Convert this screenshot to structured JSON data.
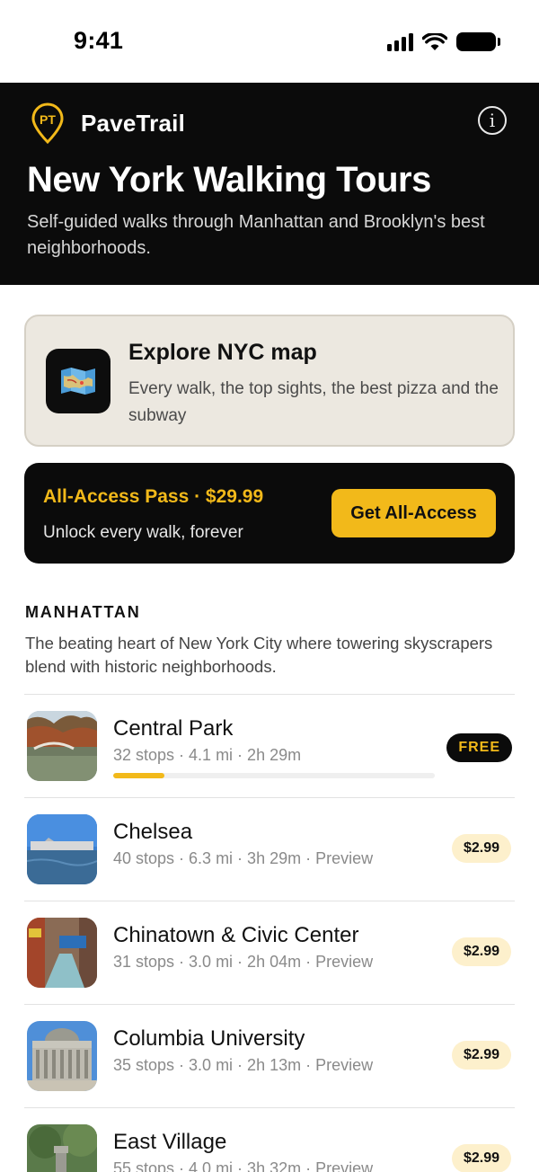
{
  "status": {
    "time": "9:41"
  },
  "header": {
    "brand_initials": "PT",
    "brand_name": "PaveTrail",
    "title": "New York Walking Tours",
    "subtitle": "Self-guided walks through Manhattan and Brooklyn's best neighborhoods."
  },
  "map_card": {
    "title": "Explore NYC map",
    "description": "Every walk, the top sights, the best pizza and the subway"
  },
  "pass": {
    "title": "All-Access Pass · $29.99",
    "subtitle": "Unlock every walk, forever",
    "button_label": "Get All-Access"
  },
  "colors": {
    "accent": "#f2b91a",
    "dark": "#0b0b0b",
    "map_card_bg": "#ece8e0",
    "price_badge_bg": "#fdf0cc"
  },
  "section": {
    "label": "MANHATTAN",
    "description": "The beating heart of New York City where towering skyscrapers blend with historic neighborhoods."
  },
  "tours": [
    {
      "name": "Central Park",
      "meta": "32 stops · 4.1 mi · 2h 29m",
      "badge": "FREE",
      "progress": 0.16
    },
    {
      "name": "Chelsea",
      "meta": "40 stops · 6.3 mi · 3h 29m · Preview",
      "badge": "$2.99"
    },
    {
      "name": "Chinatown & Civic Center",
      "meta": "31 stops · 3.0 mi · 2h 04m · Preview",
      "badge": "$2.99"
    },
    {
      "name": "Columbia University",
      "meta": "35 stops · 3.0 mi · 2h 13m · Preview",
      "badge": "$2.99"
    },
    {
      "name": "East Village",
      "meta": "55 stops · 4.0 mi · 3h 32m · Preview",
      "badge": "$2.99"
    }
  ]
}
